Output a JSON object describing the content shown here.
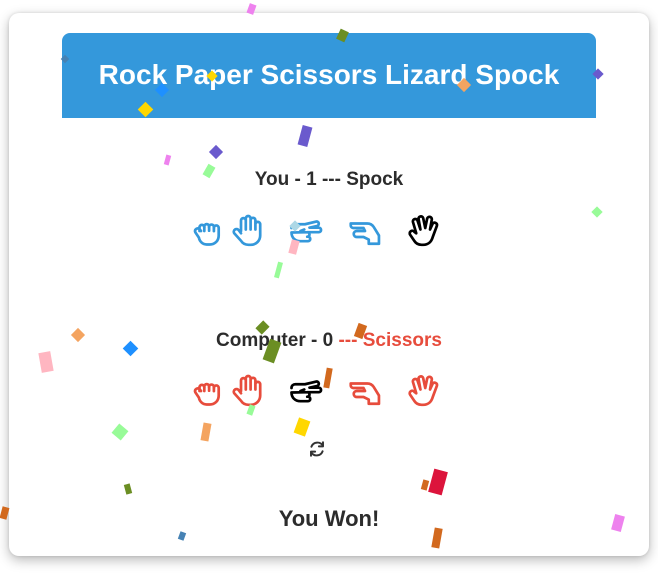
{
  "title": "Rock Paper Scissors Lizard Spock",
  "user": {
    "label": "You",
    "score": "1",
    "separator": "---",
    "choice": "Spock",
    "color": "#3498db"
  },
  "computer": {
    "label": "Computer",
    "score": "0",
    "separator": "---",
    "choice": "Scissors",
    "color": "#e74c3c"
  },
  "choices": [
    {
      "name": "Rock",
      "icon": "hand-rock-icon"
    },
    {
      "name": "Paper",
      "icon": "hand-paper-icon"
    },
    {
      "name": "Scissors",
      "icon": "hand-scissors-icon"
    },
    {
      "name": "Lizard",
      "icon": "hand-lizard-icon"
    },
    {
      "name": "Spock",
      "icon": "hand-spock-icon"
    }
  ],
  "user_selected": "Spock",
  "computer_selected": "Scissors",
  "reset_icon": "sync-icon",
  "result": "You Won!",
  "colors": {
    "header": "#3498db",
    "selected": "#000000",
    "confetti": [
      "#ee82ee",
      "#6b8e23",
      "#6a5acd",
      "#ffd700",
      "#f4a460",
      "#d2691e",
      "#ffb6c1",
      "#98fb98",
      "#1e90ff",
      "#dc143c",
      "#4682b4",
      "#add8e6"
    ]
  }
}
